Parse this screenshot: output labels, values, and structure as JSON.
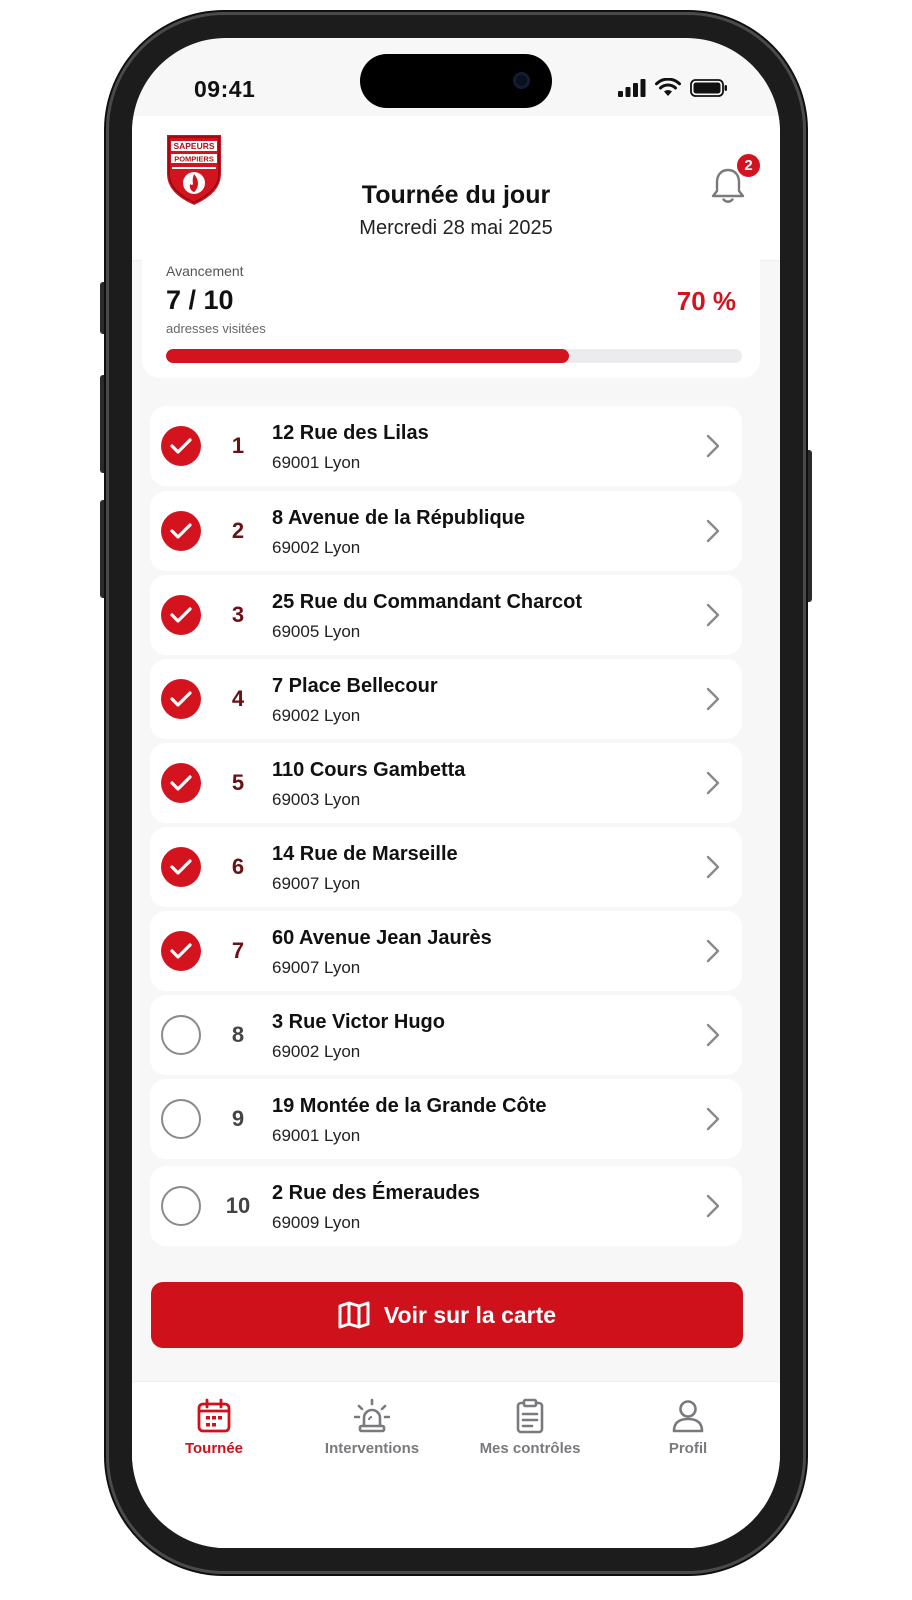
{
  "status_bar": {
    "time": "09:41"
  },
  "header": {
    "logo_text": "SAPEURS POMPIERS",
    "title": "Tournée du jour",
    "date": "Mercredi 28 mai 2025",
    "notifications_count": "2"
  },
  "progress": {
    "label": "Avancement",
    "count": "7 / 10",
    "sublabel": "adresses visitées",
    "percent_text": "70 %",
    "value": 0.7
  },
  "addresses": [
    {
      "number": "1",
      "street": "12 Rue des Lilas",
      "city": "69001 Lyon",
      "visited": true
    },
    {
      "number": "2",
      "street": "8 Avenue de la République",
      "city": "69002 Lyon",
      "visited": true
    },
    {
      "number": "3",
      "street": "25 Rue du Commandant Charcot",
      "city": "69005 Lyon",
      "visited": true
    },
    {
      "number": "4",
      "street": "7 Place Bellecour",
      "city": "69002 Lyon",
      "visited": true
    },
    {
      "number": "5",
      "street": "110 Cours Gambetta",
      "city": "69003 Lyon",
      "visited": true
    },
    {
      "number": "6",
      "street": "14 Rue de Marseille",
      "city": "69007 Lyon",
      "visited": true
    },
    {
      "number": "7",
      "street": "60 Avenue Jean Jaurès",
      "city": "69007 Lyon",
      "visited": true
    },
    {
      "number": "8",
      "street": "3 Rue Victor Hugo",
      "city": "69002 Lyon",
      "visited": false
    },
    {
      "number": "9",
      "street": "19 Montée de la Grande Côte",
      "city": "69001 Lyon",
      "visited": false
    },
    {
      "number": "10",
      "street": "2 Rue des Émeraudes",
      "city": "69009 Lyon",
      "visited": false
    }
  ],
  "map_button": {
    "label": "Voir sur la carte",
    "icon": "map-icon"
  },
  "tabs": [
    {
      "label": "Tournée",
      "icon": "calendar-icon",
      "active": true
    },
    {
      "label": "Interventions",
      "icon": "siren-icon",
      "active": false
    },
    {
      "label": "Mes contrôles",
      "icon": "clipboard-icon",
      "active": false
    },
    {
      "label": "Profil",
      "icon": "user-icon",
      "active": false
    }
  ],
  "colors": {
    "accent": "#cf111b",
    "background": "#f7f7f8",
    "muted": "#7a7a7e"
  }
}
